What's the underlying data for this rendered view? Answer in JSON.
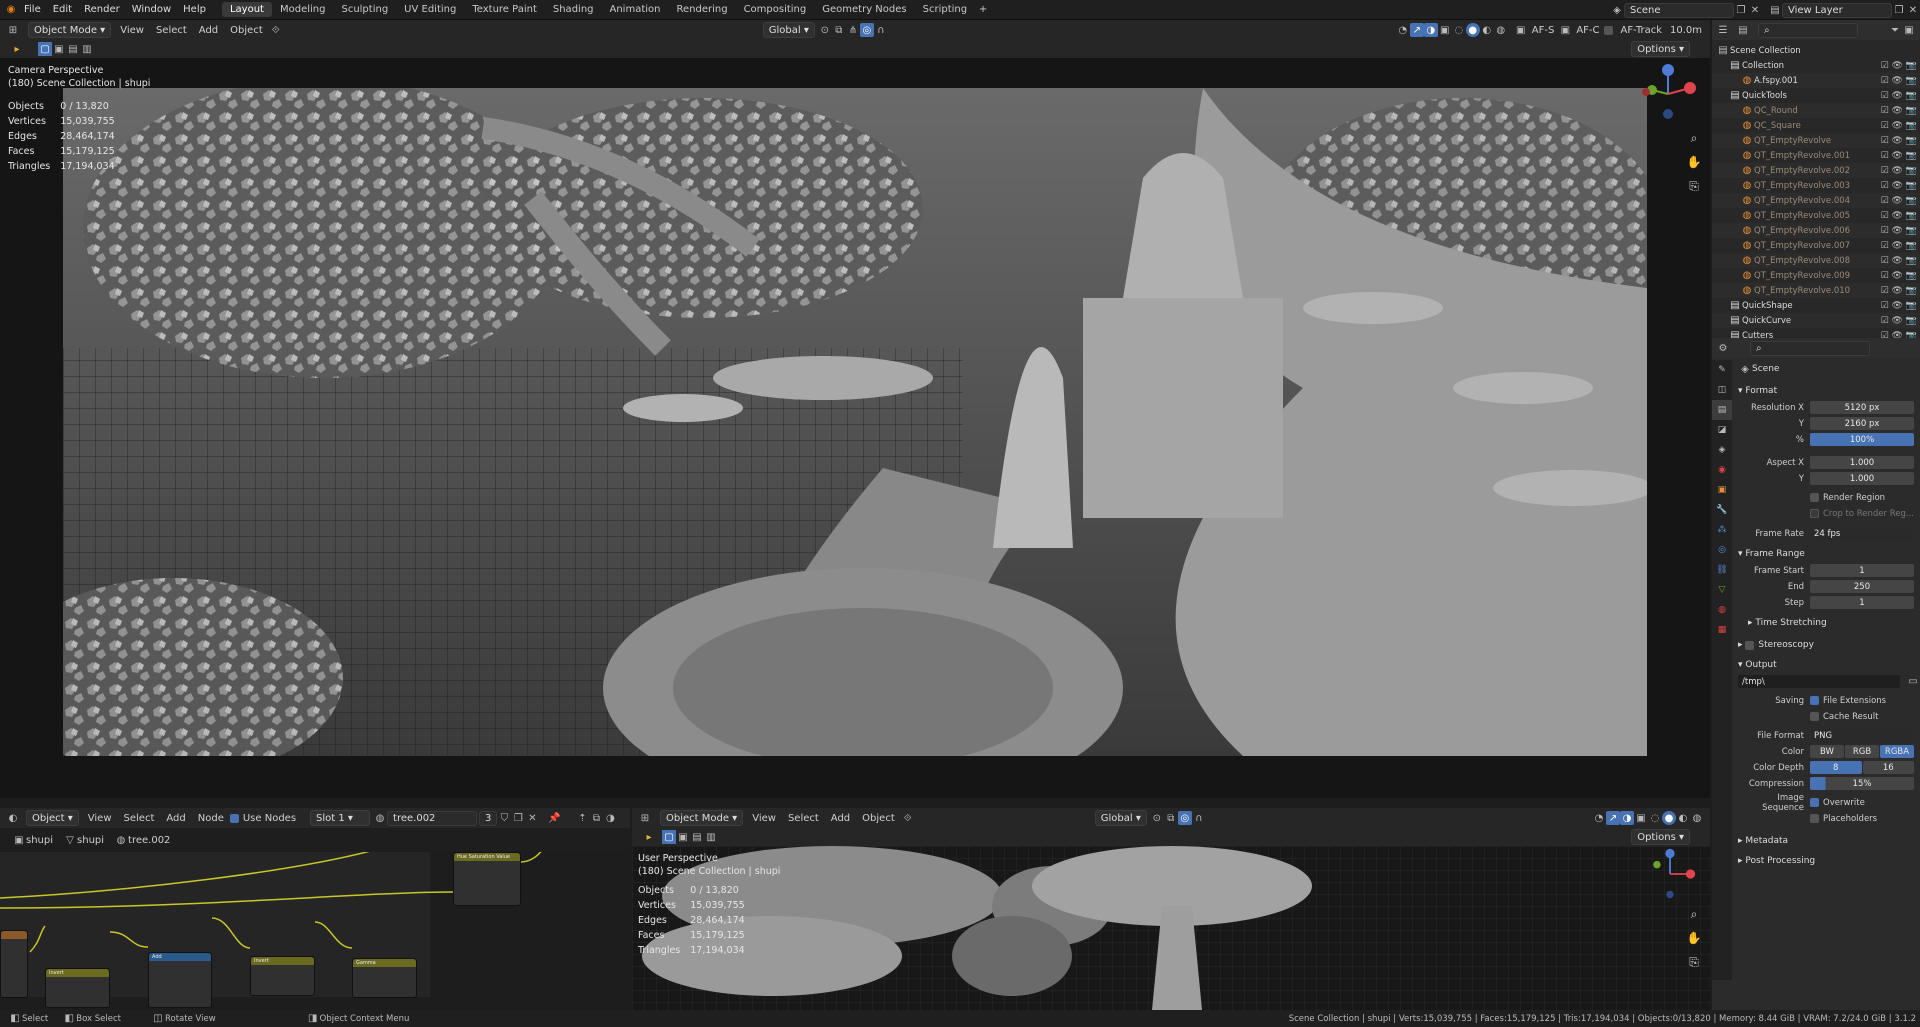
{
  "menu": [
    "File",
    "Edit",
    "Render",
    "Window",
    "Help"
  ],
  "workspaces": [
    {
      "label": "Layout",
      "active": true
    },
    {
      "label": "Modeling"
    },
    {
      "label": "Sculpting"
    },
    {
      "label": "UV Editing"
    },
    {
      "label": "Texture Paint"
    },
    {
      "label": "Shading"
    },
    {
      "label": "Animation"
    },
    {
      "label": "Rendering"
    },
    {
      "label": "Compositing"
    },
    {
      "label": "Geometry Nodes"
    },
    {
      "label": "Scripting"
    },
    {
      "label": "Scripting"
    }
  ],
  "topright": {
    "scene": "Scene",
    "view_layer": "View Layer"
  },
  "viewport": {
    "mode": "Object Mode",
    "menus": [
      "View",
      "Select",
      "Add",
      "Object"
    ],
    "orientation": "Global",
    "af_s": "AF-S",
    "af_c": "AF-C",
    "af_track": "AF-Track",
    "distance": "10.0m",
    "options": "Options",
    "title": "Camera Perspective",
    "subtitle": "(180) Scene Collection | shupi",
    "stats": [
      {
        "label": "Objects",
        "value": "0 / 13,820"
      },
      {
        "label": "Vertices",
        "value": "15,039,755"
      },
      {
        "label": "Edges",
        "value": "28,464,174"
      },
      {
        "label": "Faces",
        "value": "15,179,125"
      },
      {
        "label": "Triangles",
        "value": "17,194,034"
      }
    ]
  },
  "outliner": {
    "root": "Scene Collection",
    "items": [
      {
        "label": "Collection",
        "indent": 1
      },
      {
        "label": "A.fspy.001",
        "indent": 2
      },
      {
        "label": "QuickTools",
        "indent": 1
      },
      {
        "label": "QC_Round",
        "indent": 2
      },
      {
        "label": "QC_Square",
        "indent": 2
      },
      {
        "label": "QT_EmptyRevolve",
        "indent": 2
      },
      {
        "label": "QT_EmptyRevolve.001",
        "indent": 2
      },
      {
        "label": "QT_EmptyRevolve.002",
        "indent": 2
      },
      {
        "label": "QT_EmptyRevolve.003",
        "indent": 2
      },
      {
        "label": "QT_EmptyRevolve.004",
        "indent": 2
      },
      {
        "label": "QT_EmptyRevolve.005",
        "indent": 2
      },
      {
        "label": "QT_EmptyRevolve.006",
        "indent": 2
      },
      {
        "label": "QT_EmptyRevolve.007",
        "indent": 2
      },
      {
        "label": "QT_EmptyRevolve.008",
        "indent": 2
      },
      {
        "label": "QT_EmptyRevolve.009",
        "indent": 2
      },
      {
        "label": "QT_EmptyRevolve.010",
        "indent": 2
      },
      {
        "label": "QuickShape",
        "indent": 1
      },
      {
        "label": "QuickCurve",
        "indent": 1
      },
      {
        "label": "Cutters",
        "indent": 1
      }
    ]
  },
  "props": {
    "scene": "Scene",
    "format": "Format",
    "res_x_label": "Resolution X",
    "res_x": "5120 px",
    "res_y_label": "Y",
    "res_y": "2160 px",
    "pct_label": "%",
    "pct": "100%",
    "aspect_x_label": "Aspect X",
    "aspect_x": "1.000",
    "aspect_y_label": "Y",
    "aspect_y": "1.000",
    "render_region": "Render Region",
    "crop": "Crop to Render Reg...",
    "frame_rate_label": "Frame Rate",
    "frame_rate": "24 fps",
    "frame_range": "Frame Range",
    "frame_start_label": "Frame Start",
    "frame_start": "1",
    "end_label": "End",
    "end": "250",
    "step_label": "Step",
    "step": "1",
    "time_stretching": "Time Stretching",
    "stereoscopy": "Stereoscopy",
    "output": "Output",
    "path": "/tmp\\",
    "saving_label": "Saving",
    "file_ext": "File Extensions",
    "cache": "Cache Result",
    "file_format_label": "File Format",
    "file_format": "PNG",
    "color_label": "Color",
    "color_opts": [
      "BW",
      "RGB",
      "RGBA"
    ],
    "depth_label": "Color Depth",
    "depth_opts": [
      "8",
      "16"
    ],
    "compression_label": "Compression",
    "compression": "15%",
    "image_seq_label": "Image Sequence",
    "overwrite": "Overwrite",
    "placeholders": "Placeholders",
    "metadata": "Metadata",
    "post_processing": "Post Processing"
  },
  "node_editor": {
    "type": "Object",
    "menus": [
      "View",
      "Select",
      "Add",
      "Node"
    ],
    "use_nodes": "Use Nodes",
    "slot": "Slot 1",
    "material": "tree.002",
    "users": "3",
    "breadcrumb": [
      "shupi",
      "shupi",
      "tree.002"
    ],
    "nodes": [
      {
        "title": "Hue Saturation Value",
        "rows": [
          "Hue 0.500",
          "Saturation 1.000",
          "Value 0.800",
          "Fac 1.000",
          "Color"
        ]
      },
      {
        "title": "Invert",
        "rows": [
          "Fac 1.000",
          "Color"
        ]
      },
      {
        "title": "Add",
        "rows": [
          "Add",
          "Clamp",
          "Value 0.800"
        ]
      },
      {
        "title": "Invert",
        "rows": [
          "Fac 1.000",
          "Color"
        ]
      },
      {
        "title": "Gamma",
        "rows": [
          "Color",
          "Gamma 5.100"
        ]
      }
    ]
  },
  "viewport2": {
    "mode": "Object Mode",
    "menus": [
      "View",
      "Select",
      "Add",
      "Object"
    ],
    "orientation": "Global",
    "options": "Options",
    "title": "User Perspective",
    "subtitle": "(180) Scene Collection | shupi",
    "stats": [
      {
        "label": "Objects",
        "value": "0 / 13,820"
      },
      {
        "label": "Vertices",
        "value": "15,039,755"
      },
      {
        "label": "Edges",
        "value": "28,464,174"
      },
      {
        "label": "Faces",
        "value": "15,179,125"
      },
      {
        "label": "Triangles",
        "value": "17,194,034"
      }
    ]
  },
  "statusbar": {
    "select": "Select",
    "box_select": "Box Select",
    "rotate": "Rotate View",
    "context": "Object Context Menu",
    "info": "Scene Collection | shupi | Verts:15,039,755 | Faces:15,179,125 | Tris:17,194,034 | Objects:0/13,820 | Memory: 8.44 GiB | VRAM: 7.2/24.0 GiB | 3.1.2"
  }
}
